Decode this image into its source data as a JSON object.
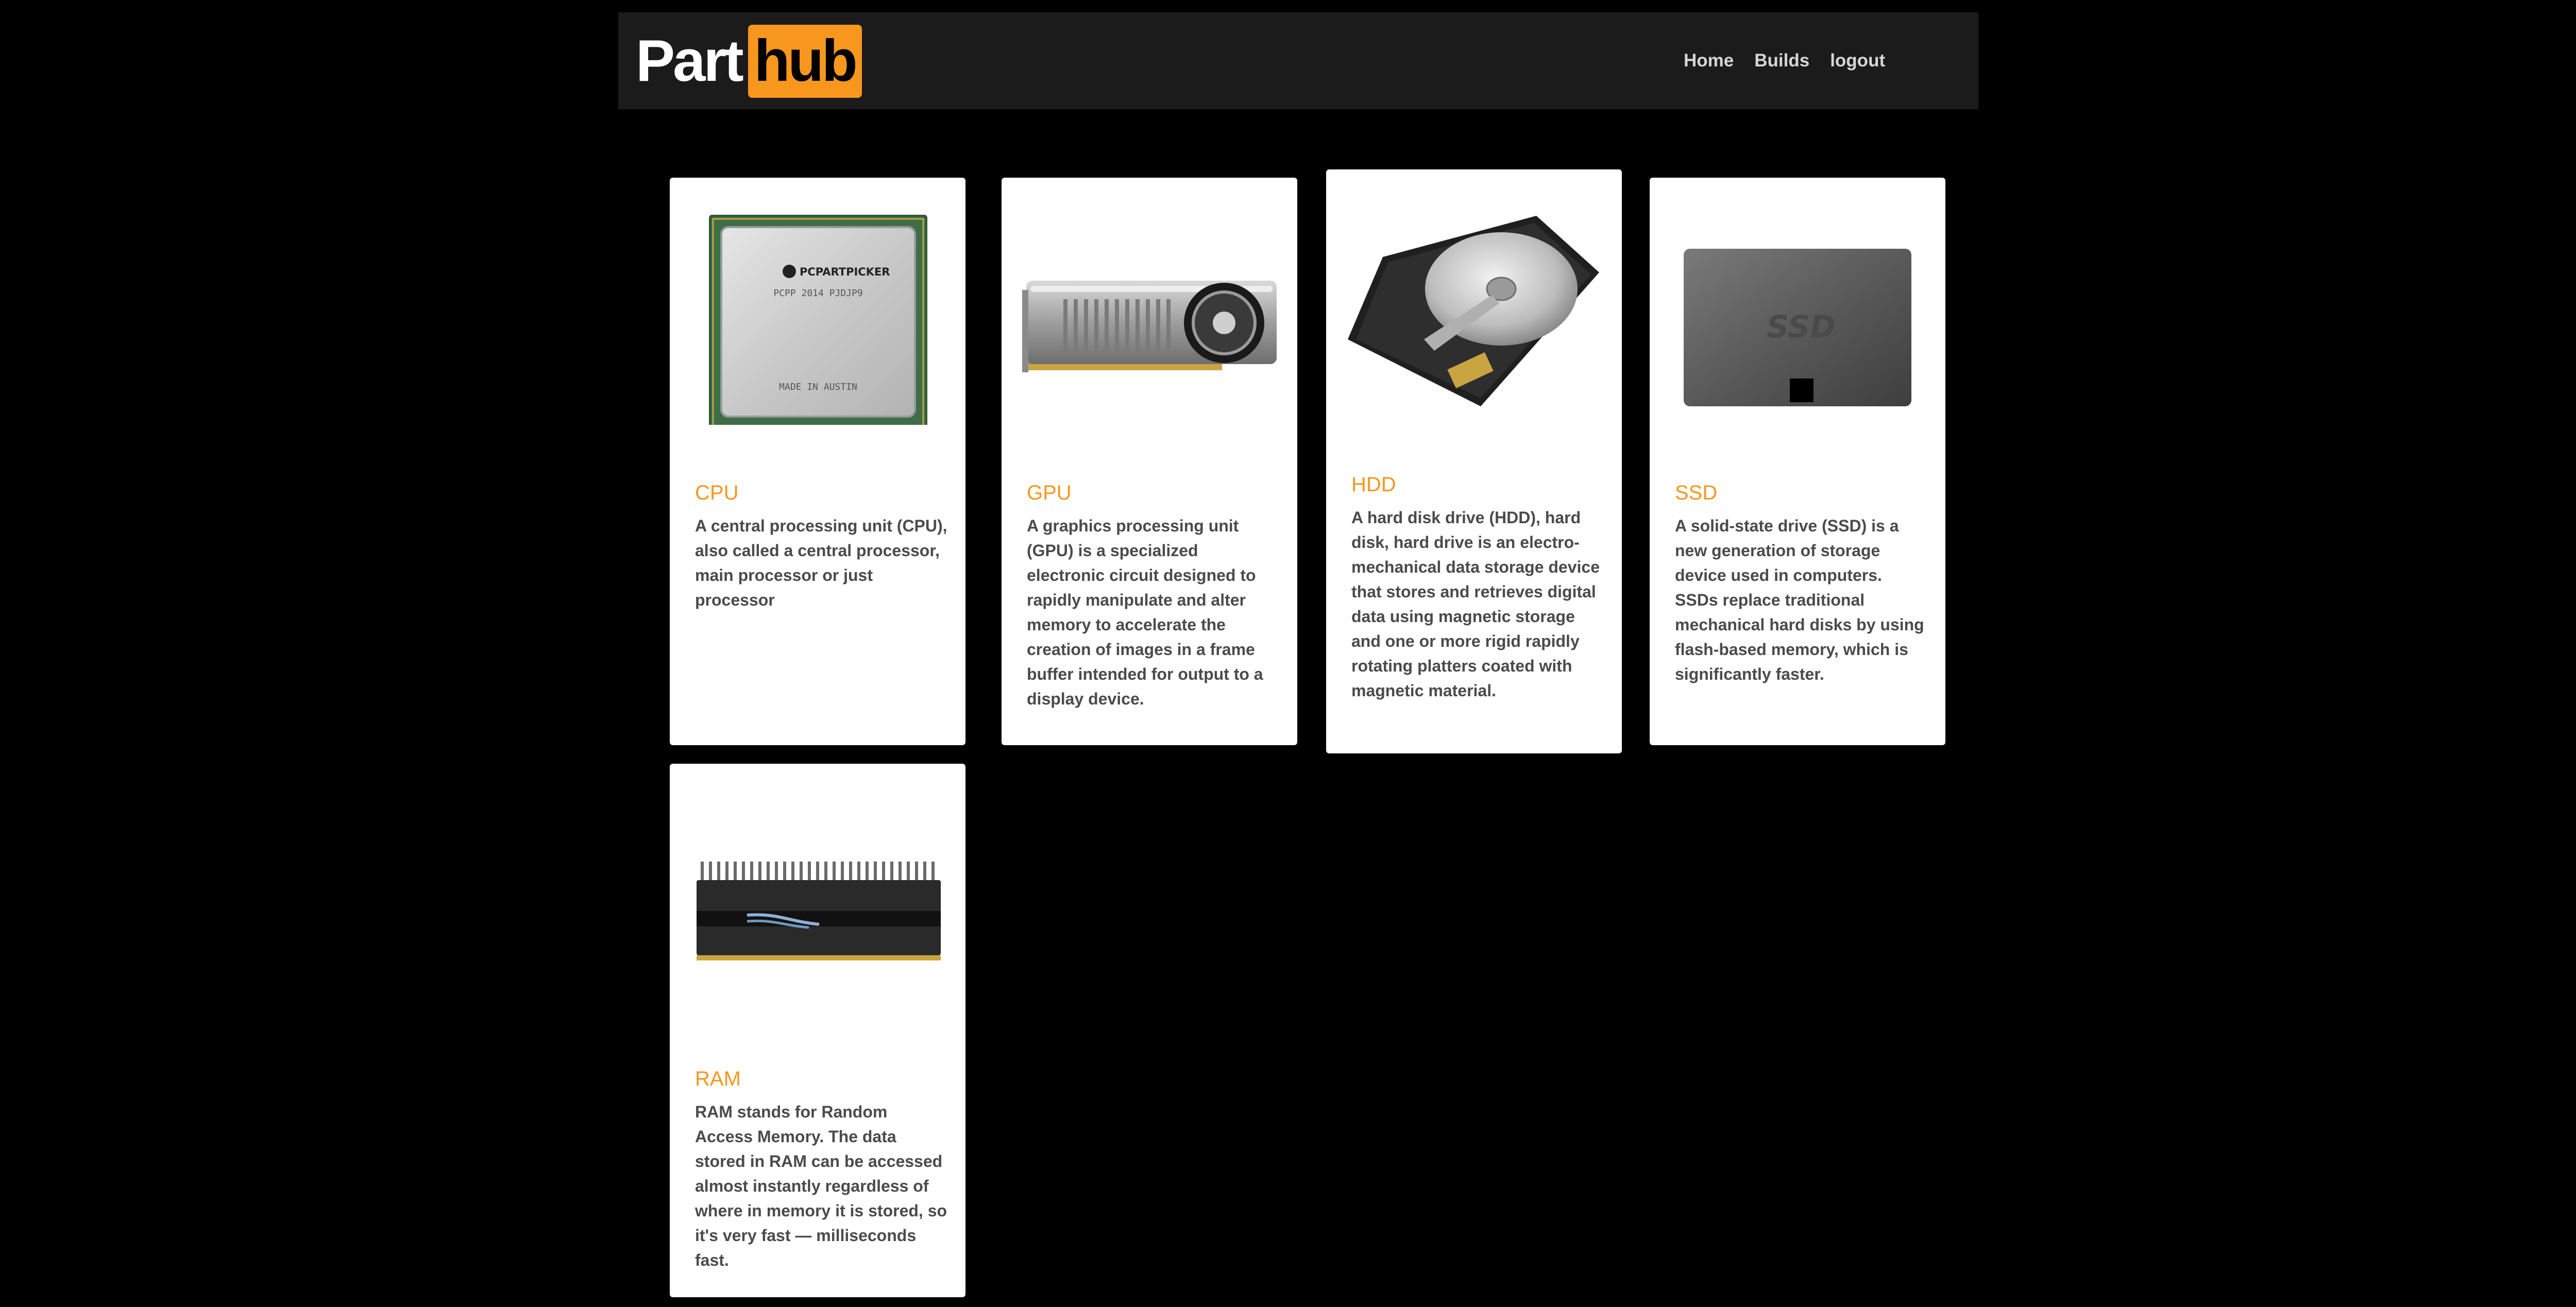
{
  "brand": {
    "part": "Part",
    "hub": "hub",
    "accent_color": "#f7971d"
  },
  "nav": {
    "home": "Home",
    "builds": "Builds",
    "logout": "logout"
  },
  "cards": [
    {
      "title": "CPU",
      "image": "cpu-image",
      "chip_brand": "PCPARTPICKER",
      "chip_model": "PCPP 2014 PJDJP9",
      "chip_origin": "MADE IN AUSTIN",
      "description": "A central processing unit (CPU), also called a central processor, main processor or just processor"
    },
    {
      "title": "GPU",
      "image": "gpu-image",
      "description": "A graphics processing unit (GPU) is a specialized electronic circuit designed to rapidly manipulate and alter memory to accelerate the creation of images in a frame buffer intended for output to a display device."
    },
    {
      "title": "HDD",
      "image": "hdd-image",
      "description": "A hard disk drive (HDD), hard disk, hard drive is an electro-mechanical data storage device that stores and retrieves digital data using magnetic storage and one or more rigid rapidly rotating platters coated with magnetic material."
    },
    {
      "title": "SSD",
      "image": "ssd-image",
      "ssd_label": "SSD",
      "description": "A solid-state drive (SSD) is a new generation of storage device used in computers. SSDs replace traditional mechanical hard disks by using flash-based memory, which is significantly faster."
    },
    {
      "title": "RAM",
      "image": "ram-image",
      "description": "RAM stands for Random Access Memory. The data stored in RAM can be accessed almost instantly regardless of where in memory it is stored, so it's very fast — milliseconds fast."
    }
  ]
}
